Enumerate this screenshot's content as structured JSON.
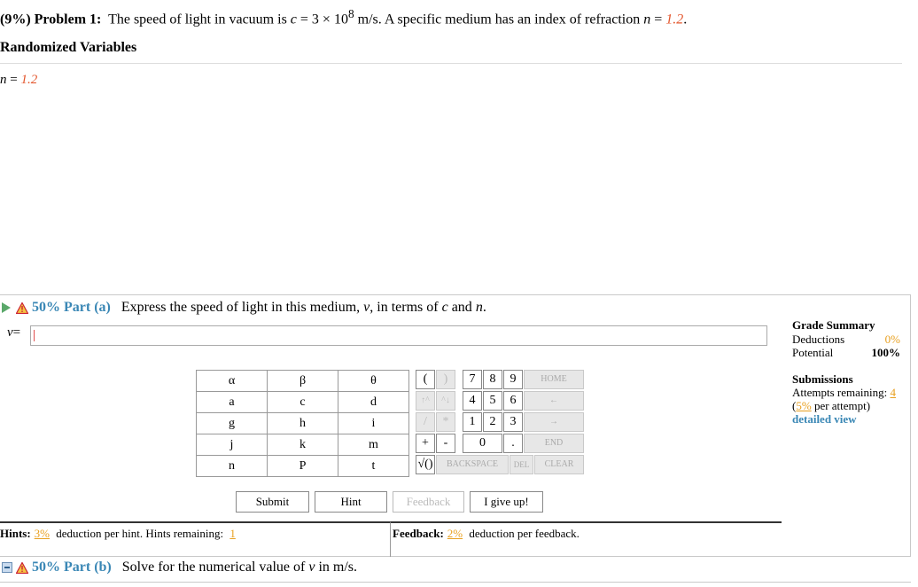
{
  "problem": {
    "prefix": "(9%)",
    "title": "Problem 1:",
    "text_before": "The speed of light in vacuum is ",
    "c_var": "c",
    "c_value": " = 3 × 10",
    "exp": "8",
    "text_mid": " m/s. A specific medium has an index of refraction ",
    "n_var": "n",
    "eq": " = ",
    "n_value": "1.2",
    "end": "."
  },
  "randomized": {
    "title": "Randomized Variables",
    "var": "n",
    "eq": " = ",
    "value": "1.2"
  },
  "part_a": {
    "pct": "50%",
    "label": "Part (a)",
    "text1": "Express the speed of light in this medium, ",
    "v": "v",
    "text2": ", in terms of ",
    "c": "c",
    "and": " and ",
    "n": "n",
    "end": ".",
    "answer_label_var": "v",
    "answer_label_eq": " =",
    "answer_value": ""
  },
  "grade_summary": {
    "title": "Grade Summary",
    "deductions_label": "Deductions",
    "deductions_value": "0%",
    "potential_label": "Potential",
    "potential_value": "100%",
    "submissions_title": "Submissions",
    "attempts_label": "Attempts remaining: ",
    "attempts_value": "4",
    "per_attempt_pct": "5%",
    "per_attempt_text": " per attempt)",
    "detailed_view": "detailed view"
  },
  "symbol_keys": [
    [
      "α",
      "β",
      "θ"
    ],
    [
      "a",
      "c",
      "d"
    ],
    [
      "g",
      "h",
      "i"
    ],
    [
      "j",
      "k",
      "m"
    ],
    [
      "n",
      "P",
      "t"
    ]
  ],
  "keypad": {
    "open_paren": "(",
    "close_paren": ")",
    "d7": "7",
    "d8": "8",
    "d9": "9",
    "home": "HOME",
    "up_arrow": "↑^",
    "down_arrow": "^↓",
    "d4": "4",
    "d5": "5",
    "d6": "6",
    "left_arrow": "←",
    "slash": "/",
    "star": "*",
    "d1": "1",
    "d2": "2",
    "d3": "3",
    "right_arrow": "→",
    "plus": "+",
    "minus": "-",
    "d0": "0",
    "dot": ".",
    "end": "END",
    "sqrt": "√()",
    "backspace": "BACKSPACE",
    "del": "DEL",
    "clear": "CLEAR"
  },
  "buttons": {
    "submit": "Submit",
    "hint": "Hint",
    "feedback": "Feedback",
    "give_up": "I give up!"
  },
  "hints": {
    "label": "Hints:",
    "pct": "3%",
    "text": " deduction per hint. Hints remaining: ",
    "remaining": "1"
  },
  "feedback_info": {
    "label": "Feedback:",
    "pct": "2%",
    "text": " deduction per feedback."
  },
  "part_b": {
    "pct": "50%",
    "label": "Part (b)",
    "text1": "Solve for the numerical value of ",
    "v": "v",
    "text2": " in m/s."
  },
  "colors": {
    "accent_blue": "#3a87b5",
    "random_red": "#e3572e",
    "orange": "#e8a020",
    "play_green": "#5aa86a"
  }
}
